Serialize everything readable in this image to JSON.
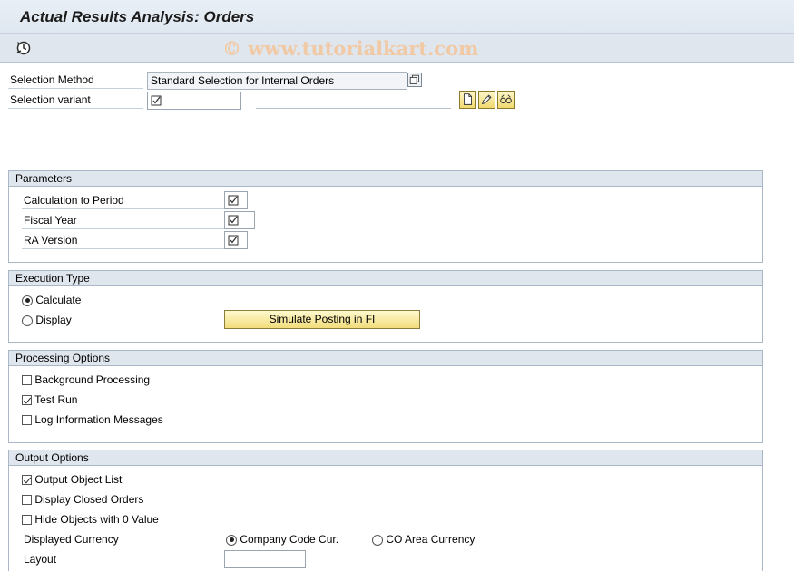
{
  "window": {
    "title": "Actual Results Analysis: Orders"
  },
  "watermark": "© www.tutorialkart.com",
  "toolbar": {
    "execute_icon": "clock-execute-icon"
  },
  "selection": {
    "method_label": "Selection Method",
    "method_value": "Standard Selection for Internal Orders",
    "variant_label": "Selection variant",
    "variant_value": "",
    "icons": [
      "create-icon",
      "edit-icon",
      "display-icon"
    ]
  },
  "parameters": {
    "title": "Parameters",
    "fields": [
      {
        "label": "Calculation to Period",
        "value": ""
      },
      {
        "label": "Fiscal Year",
        "value": ""
      },
      {
        "label": "RA Version",
        "value": ""
      }
    ]
  },
  "execution": {
    "title": "Execution Type",
    "calculate_label": "Calculate",
    "display_label": "Display",
    "selected": "Calculate",
    "simulate_button": "Simulate Posting in FI"
  },
  "processing": {
    "title": "Processing Options",
    "options": [
      {
        "label": "Background Processing",
        "checked": false
      },
      {
        "label": "Test Run",
        "checked": true
      },
      {
        "label": "Log Information Messages",
        "checked": false
      }
    ]
  },
  "output": {
    "title": "Output Options",
    "options": [
      {
        "label": "Output Object List",
        "checked": true
      },
      {
        "label": "Display Closed Orders",
        "checked": false
      },
      {
        "label": "Hide Objects with 0 Value",
        "checked": false
      }
    ],
    "currency_label": "Displayed Currency",
    "currency_company": "Company Code Cur.",
    "currency_coarea": "CO Area Currency",
    "currency_selected": "Company Code Cur.",
    "layout_label": "Layout",
    "layout_value": ""
  }
}
